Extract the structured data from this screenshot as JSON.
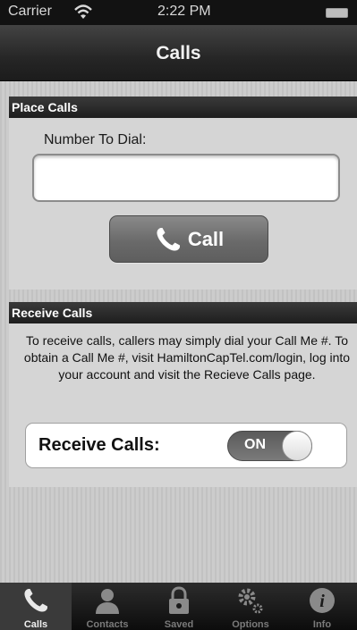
{
  "status_bar": {
    "carrier": "Carrier",
    "time": "2:22 PM"
  },
  "nav": {
    "title": "Calls"
  },
  "place_calls": {
    "header": "Place Calls",
    "number_label": "Number To Dial:",
    "number_value": "",
    "number_placeholder": "",
    "call_button_label": "Call"
  },
  "receive_calls": {
    "header": "Receive Calls",
    "description": "To receive calls, callers may simply dial your Call Me #. To obtain a Call Me #, visit HamiltonCapTel.com/login, log into your account and visit the Recieve Calls page.",
    "toggle_label": "Receive Calls:",
    "toggle_state": "ON"
  },
  "tabs": [
    {
      "label": "Calls",
      "icon": "phone-icon",
      "active": true
    },
    {
      "label": "Contacts",
      "icon": "person-icon",
      "active": false
    },
    {
      "label": "Saved",
      "icon": "lock-icon",
      "active": false
    },
    {
      "label": "Options",
      "icon": "gear-icon",
      "active": false
    },
    {
      "label": "Info",
      "icon": "info-icon",
      "active": false
    }
  ],
  "colors": {
    "nav_bar": "#262626",
    "content_bg": "#c6c6c6",
    "button": "#6a6a6a"
  }
}
